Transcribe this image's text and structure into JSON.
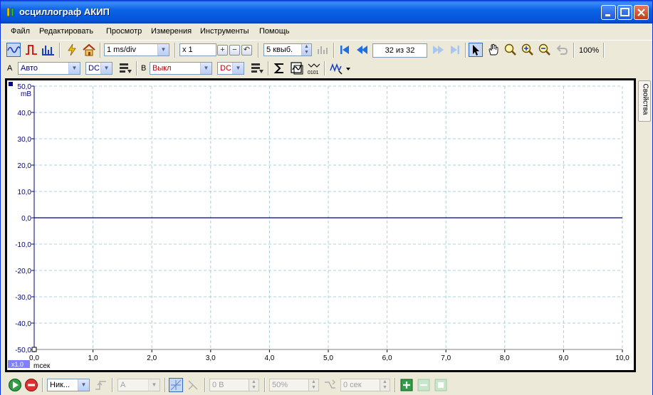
{
  "window": {
    "title": "осциллограф АКИП"
  },
  "menu": [
    "Файл",
    "Редактировать",
    "Просмотр",
    "Измерения",
    "Инструменты",
    "Помощь"
  ],
  "toolbar1": {
    "timebase": "1 ms/div",
    "zoom_factor": "x 1",
    "samples": "5 квыб.",
    "capture_counter": "32 из 32",
    "zoom_level": "100%"
  },
  "toolbar2": {
    "channel_a_label": "A",
    "channel_a_range": "Авто",
    "channel_a_coupling": "DC",
    "channel_b_label": "B",
    "channel_b_range": "Выкл",
    "channel_b_coupling": "DC"
  },
  "side_tab": "Свойства",
  "scope": {
    "y_unit": "mB",
    "x_unit": "mсек",
    "x_scale_badge": "x1.0",
    "y_ticks": [
      "50,0",
      "40,0",
      "30,0",
      "20,0",
      "10,0",
      "0,0",
      "-10,0",
      "-20,0",
      "-30,0",
      "-40,0",
      "-50,0"
    ],
    "x_ticks": [
      "0,0",
      "1,0",
      "2,0",
      "3,0",
      "4,0",
      "5,0",
      "6,0",
      "7,0",
      "8,0",
      "9,0",
      "10,0"
    ],
    "colors": {
      "trace": "#000080",
      "grid": "#a8d0dc",
      "axis_label": "#000080"
    }
  },
  "statusbar": {
    "trigger_mode": "Ник...",
    "trigger_channel": "A",
    "trigger_level": "0 В",
    "pretrigger": "50%",
    "delay": "0 сек"
  },
  "chart_data": {
    "type": "line",
    "xlabel": "mсек",
    "ylabel": "mB",
    "xlim": [
      0,
      10
    ],
    "ylim": [
      -50,
      50
    ],
    "grid": true,
    "series": [
      {
        "x": [
          0,
          10
        ],
        "y": [
          0,
          0
        ]
      }
    ]
  }
}
